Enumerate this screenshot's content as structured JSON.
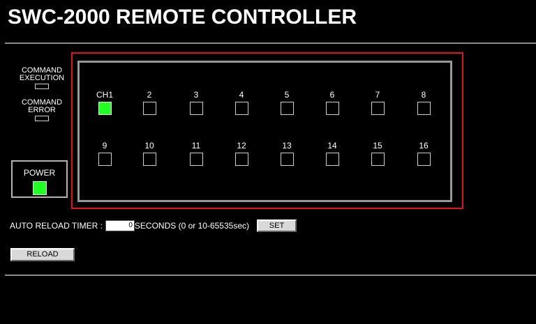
{
  "header": {
    "title": "SWC-2000 REMOTE CONTROLLER"
  },
  "status": {
    "command_execution_label": "COMMAND EXECUTION",
    "command_error_label": "COMMAND ERROR"
  },
  "power": {
    "label": "POWER",
    "on": true
  },
  "channels": [
    {
      "label": "CH1",
      "on": true
    },
    {
      "label": "2",
      "on": false
    },
    {
      "label": "3",
      "on": false
    },
    {
      "label": "4",
      "on": false
    },
    {
      "label": "5",
      "on": false
    },
    {
      "label": "6",
      "on": false
    },
    {
      "label": "7",
      "on": false
    },
    {
      "label": "8",
      "on": false
    },
    {
      "label": "9",
      "on": false
    },
    {
      "label": "10",
      "on": false
    },
    {
      "label": "11",
      "on": false
    },
    {
      "label": "12",
      "on": false
    },
    {
      "label": "13",
      "on": false
    },
    {
      "label": "14",
      "on": false
    },
    {
      "label": "15",
      "on": false
    },
    {
      "label": "16",
      "on": false
    }
  ],
  "timer": {
    "label": "AUTO RELOAD TIMER :",
    "value": "0",
    "suffix": "SECONDS (0 or 10-65535sec)",
    "set_label": "SET"
  },
  "reload": {
    "label": "RELOAD"
  },
  "colors": {
    "background": "#000000",
    "indicator_on": "#22ff22",
    "frame_outer": "#e0141e",
    "frame_inner": "#999999"
  }
}
